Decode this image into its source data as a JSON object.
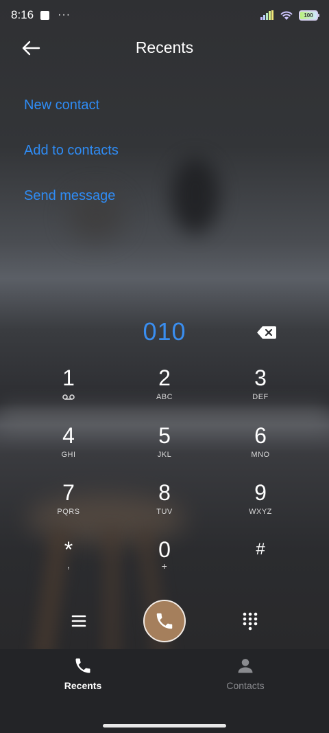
{
  "status": {
    "time": "8:16",
    "more": "···",
    "battery": "100"
  },
  "header": {
    "title": "Recents"
  },
  "menu": {
    "items": [
      {
        "label": "New contact"
      },
      {
        "label": "Add to contacts"
      },
      {
        "label": "Send message"
      }
    ]
  },
  "dialer": {
    "number": "010"
  },
  "keypad": {
    "keys": [
      {
        "digit": "1",
        "letters": ""
      },
      {
        "digit": "2",
        "letters": "ABC"
      },
      {
        "digit": "3",
        "letters": "DEF"
      },
      {
        "digit": "4",
        "letters": "GHI"
      },
      {
        "digit": "5",
        "letters": "JKL"
      },
      {
        "digit": "6",
        "letters": "MNO"
      },
      {
        "digit": "7",
        "letters": "PQRS"
      },
      {
        "digit": "8",
        "letters": "TUV"
      },
      {
        "digit": "9",
        "letters": "WXYZ"
      },
      {
        "digit": "*",
        "letters": ","
      },
      {
        "digit": "0",
        "letters": "+"
      },
      {
        "digit": "#",
        "letters": ""
      }
    ]
  },
  "tabs": {
    "recents": "Recents",
    "contacts": "Contacts"
  },
  "colors": {
    "accent": "#2f8cf5",
    "call_button": "#a57f5c"
  }
}
